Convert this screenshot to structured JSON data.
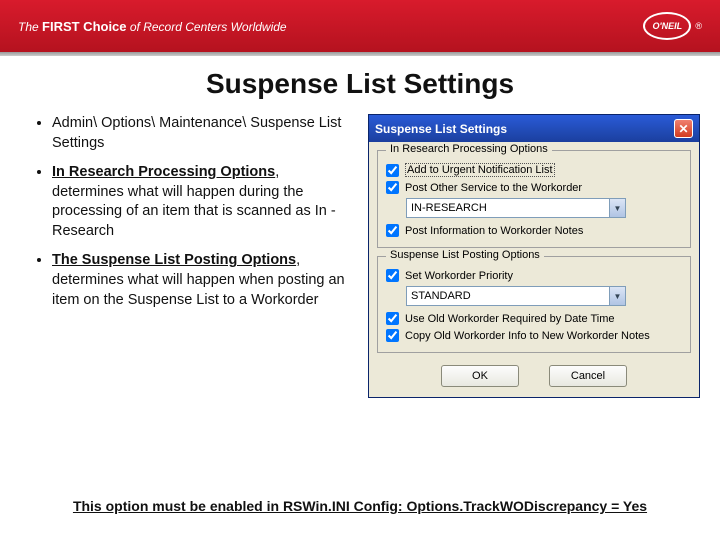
{
  "banner": {
    "tagline_prefix": "The ",
    "tagline_bold": "FIRST Choice",
    "tagline_suffix": " of Record Centers Worldwide",
    "logo_text": "O'NEIL",
    "reg": "®"
  },
  "title": "Suspense List Settings",
  "bullets": [
    {
      "text": "Admin\\ Options\\ Maintenance\\ Suspense List Settings"
    },
    {
      "bold1": "In Research Processing Options",
      "rest": ", determines what will happen during the processing of an item that is scanned as In -Research"
    },
    {
      "bold1": "The Suspense List Posting Options",
      "rest": ", determines what will happen when posting an item on the Suspense List to a Workorder"
    }
  ],
  "dialog": {
    "title": "Suspense List Settings",
    "group1": {
      "legend": "In Research Processing Options",
      "chk1": "Add to Urgent Notification List",
      "chk2": "Post Other Service to the Workorder",
      "select": "IN-RESEARCH",
      "chk3": "Post Information to Workorder Notes"
    },
    "group2": {
      "legend": "Suspense List Posting Options",
      "chk1": "Set Workorder Priority",
      "select": "STANDARD",
      "chk2": "Use Old Workorder Required by Date Time",
      "chk3": "Copy Old Workorder Info to New Workorder Notes"
    },
    "ok": "OK",
    "cancel": "Cancel"
  },
  "footer": "This option must be enabled in RSWin.INI Config: Options.TrackWODiscrepancy = Yes"
}
